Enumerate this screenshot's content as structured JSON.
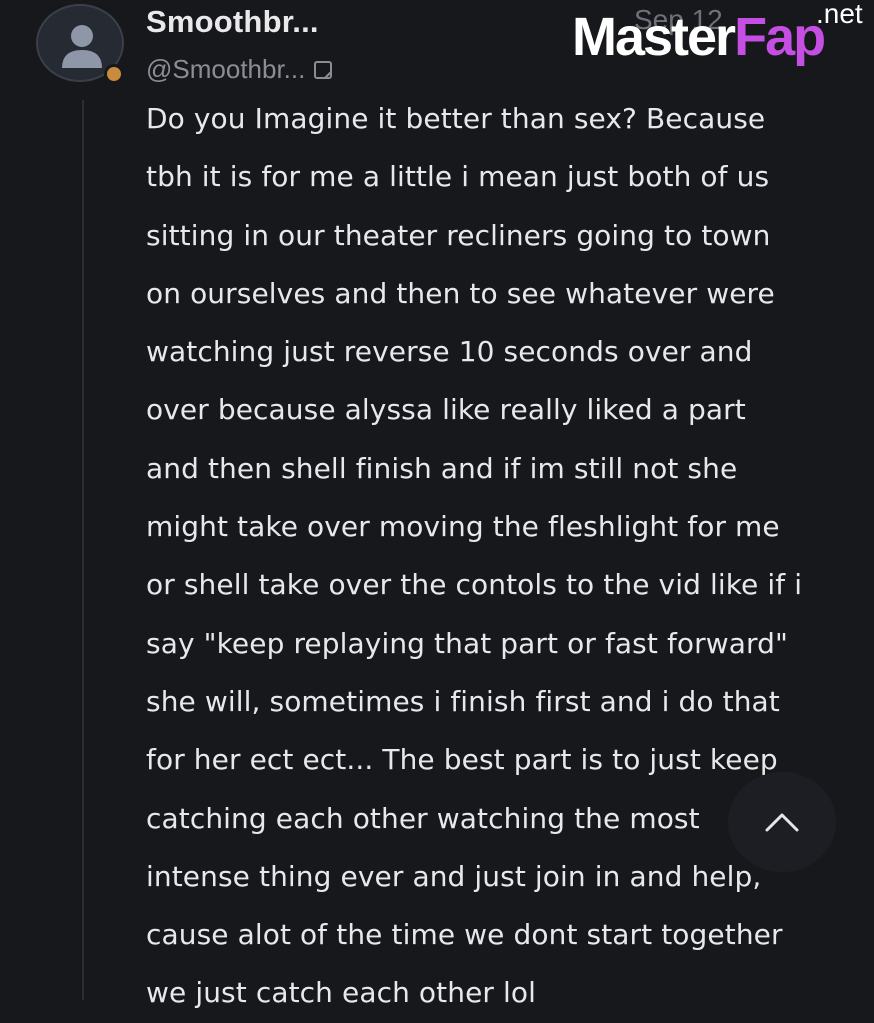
{
  "post": {
    "display_name": "Smoothbr...",
    "handle": "@Smoothbr...",
    "date": "Sep 12",
    "body": "Do you Imagine it better than sex? Because\ntbh it is for me a little i mean just both of us\nsitting in our theater recliners going to town\non ourselves and then to see whatever were\nwatching just reverse 10 seconds over and\nover because alyssa like really liked a part\nand then shell finish and if im still not she\nmight take over moving the fleshlight for me\nor shell take over the contols to the vid like if i\nsay \"keep replaying that part or fast forward\"\nshe will, sometimes i finish first and i do that\nfor her ect ect... The best part is to just keep\ncatching each other watching the most\nintense thing ever and just join in and help,\ncause alot of the time we dont start together\nwe just catch each other lol"
  },
  "watermark": {
    "main": "Master",
    "accent": "Fap",
    "suffix": ".net"
  },
  "icons": {
    "avatar": "user-silhouette-icon",
    "status": "status-dot-icon",
    "note": "note-edit-icon",
    "scroll": "chevron-up-icon"
  },
  "colors": {
    "background": "#17181c",
    "status_dot": "#c98b3e",
    "watermark_accent": "#c54ee3"
  }
}
